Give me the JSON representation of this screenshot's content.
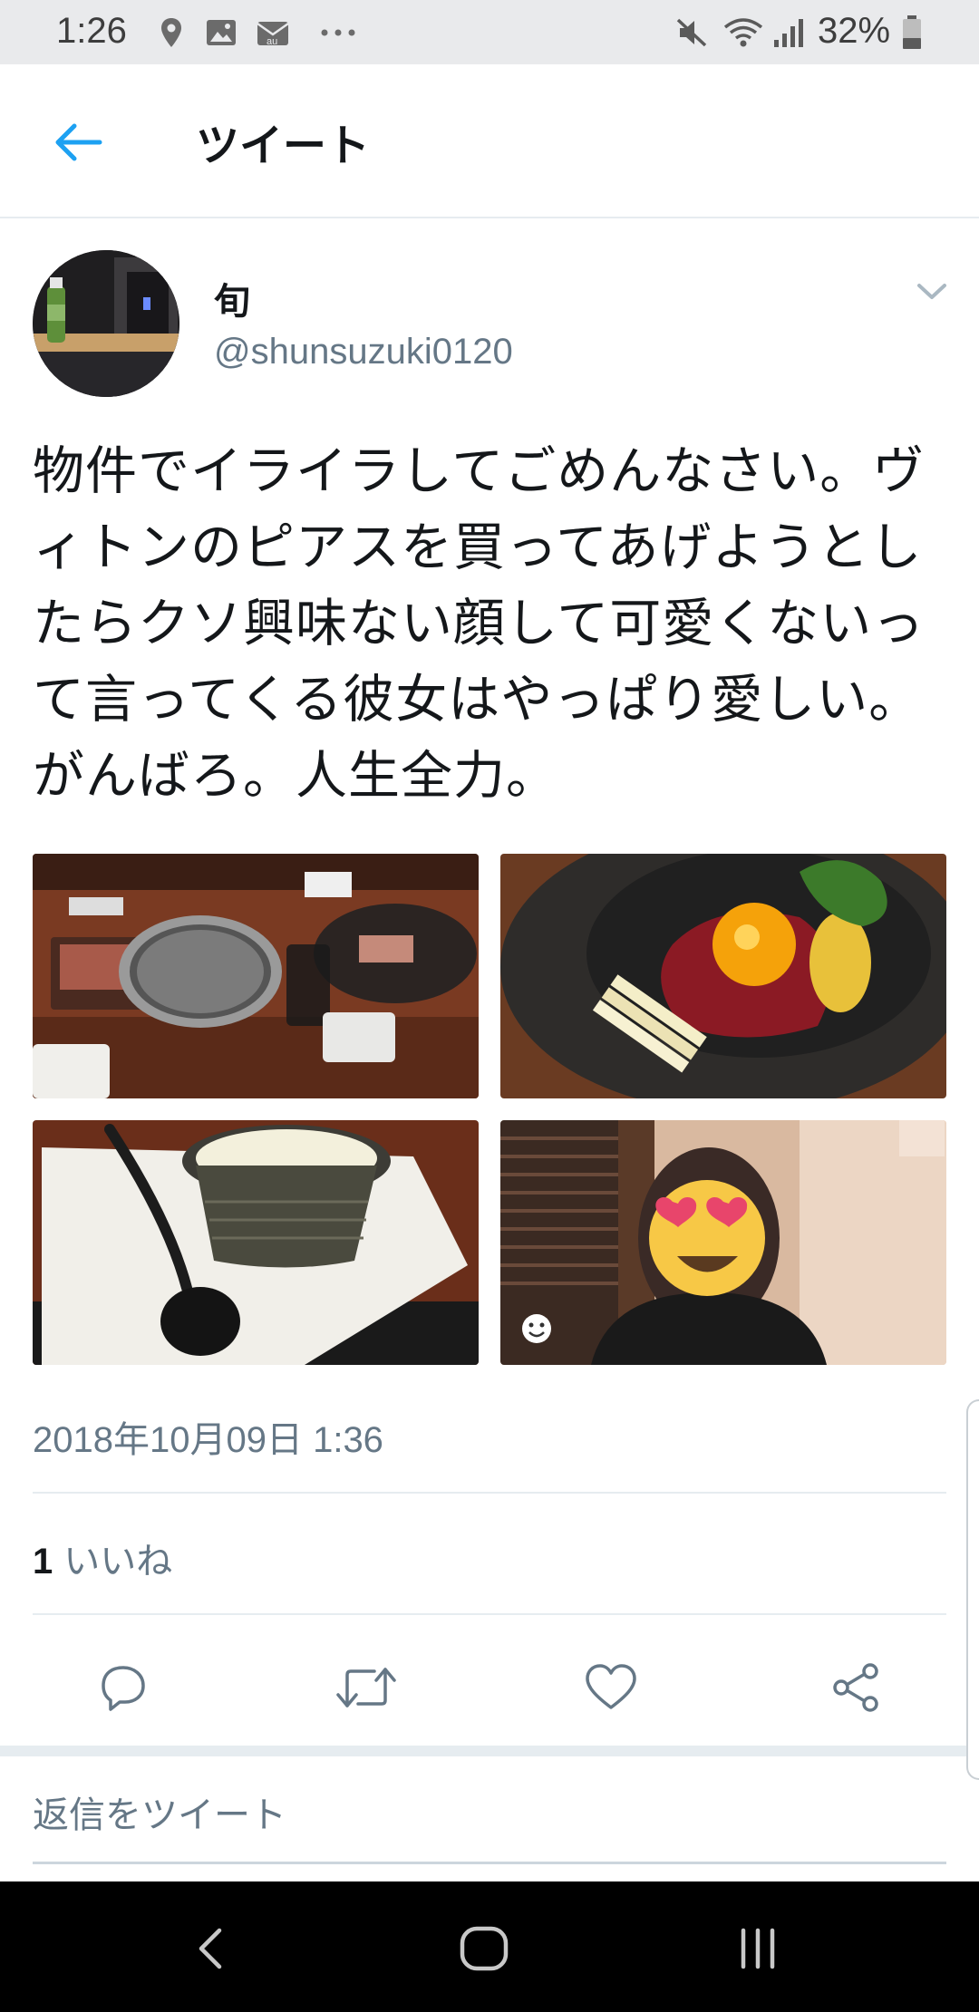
{
  "status_bar": {
    "time": "1:26",
    "battery": "32%",
    "icons": [
      "location-icon",
      "gallery-icon",
      "au-mail-icon",
      "more-notifications-icon",
      "mute-icon",
      "wifi-icon",
      "signal-icon",
      "battery-icon"
    ]
  },
  "header": {
    "title": "ツイート",
    "back_icon": "back-arrow-icon",
    "accent_color": "#1da1f2"
  },
  "tweet": {
    "author_name": "旬",
    "author_handle": "@shunsuzuki0120",
    "text": "物件でイライラしてごめんなさい。ヴィトンのピアスを買ってあげようとしたらクソ興味ない顔して可愛くないって言ってくる彼女はやっぱり愛しい。がんばろ。人生全力。",
    "media": [
      {
        "alt_icon": "yakiniku-table-photo"
      },
      {
        "alt_icon": "yukhoe-plate-photo"
      },
      {
        "alt_icon": "drink-cup-spoon-photo"
      },
      {
        "alt_icon": "person-heart-eyes-emoji-photo"
      }
    ],
    "timestamp": "2018年10月09日 1:36",
    "likes_count": "1",
    "likes_label": "いいね"
  },
  "actions": [
    "reply-icon",
    "retweet-icon",
    "like-icon",
    "share-icon"
  ],
  "reply": {
    "placeholder": "返信をツイート"
  },
  "nav": [
    "back-nav-icon",
    "home-nav-icon",
    "recents-nav-icon"
  ]
}
